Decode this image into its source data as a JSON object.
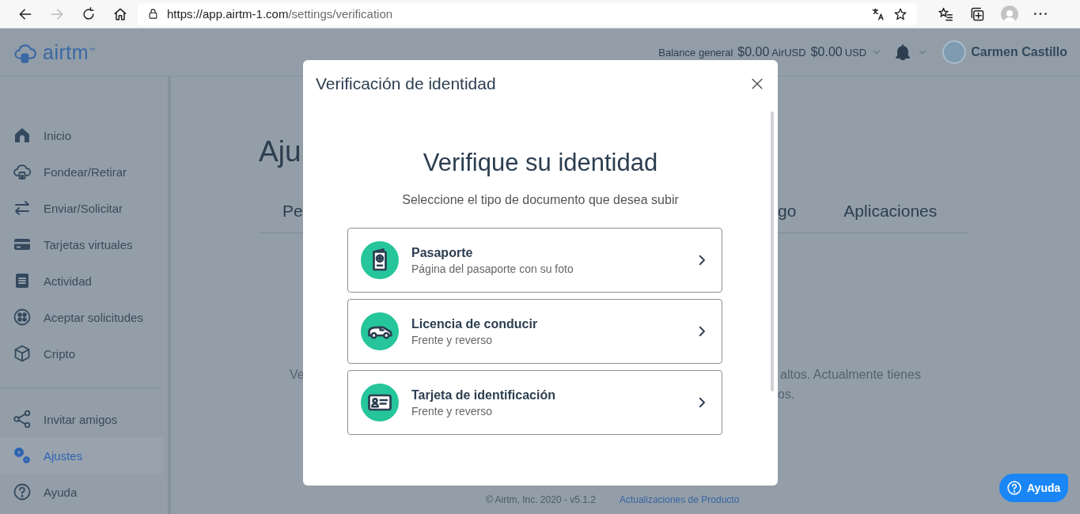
{
  "browser": {
    "url": {
      "origin": "https://app.airtm-1.com",
      "path": "/settings/verification"
    }
  },
  "header": {
    "logo": "airtm$^{™}$",
    "balance_label": "Balance general",
    "balances": [
      {
        "amount": "$0.00",
        "currency": "AirUSD"
      },
      {
        "amount": "$0.00",
        "currency": "USD"
      }
    ],
    "user_name": "Carmen Castillo"
  },
  "sidebar": {
    "groups": [
      {
        "items": [
          {
            "label": "Inicio",
            "selected": false
          },
          {
            "label": "Fondear/Retirar",
            "selected": false
          },
          {
            "label": "Enviar/Solicitar",
            "selected": false
          },
          {
            "label": "Tarjetas virtuales",
            "selected": false
          },
          {
            "label": "Actividad",
            "selected": false
          },
          {
            "label": "Aceptar solicitudes",
            "selected": false
          },
          {
            "label": "Cripto",
            "selected": false
          }
        ]
      },
      {
        "items": [
          {
            "label": "Invitar amigos",
            "selected": false
          },
          {
            "label": "Ajustes",
            "selected": true
          },
          {
            "label": "Ayuda",
            "selected": false
          }
        ]
      }
    ]
  },
  "page": {
    "title": "Aju",
    "tabs_left": [
      "Pe"
    ],
    "tabs_right": [
      "go",
      "Aplicaciones"
    ],
    "text_left": [
      "Ve"
    ],
    "text_right": [
      "altos. Actualmente tienes",
      "os."
    ]
  },
  "modal": {
    "title": "Verificación de identidad",
    "heading": "Verifique su identidad",
    "subtitle": "Seleccione el tipo de documento que desea subir",
    "options": [
      {
        "title": "Pasaporte",
        "subtitle": "Página del pasaporte con su foto"
      },
      {
        "title": "Licencia de conducir",
        "subtitle": "Frente y reverso"
      },
      {
        "title": "Tarjeta de identificación",
        "subtitle": "Frente y reverso"
      }
    ]
  },
  "help_button": "Ayuda",
  "footer": {
    "copyright": "© Airtm, Inc. 2020 - v5.1.2",
    "link": "Actualizaciones de Producto"
  }
}
